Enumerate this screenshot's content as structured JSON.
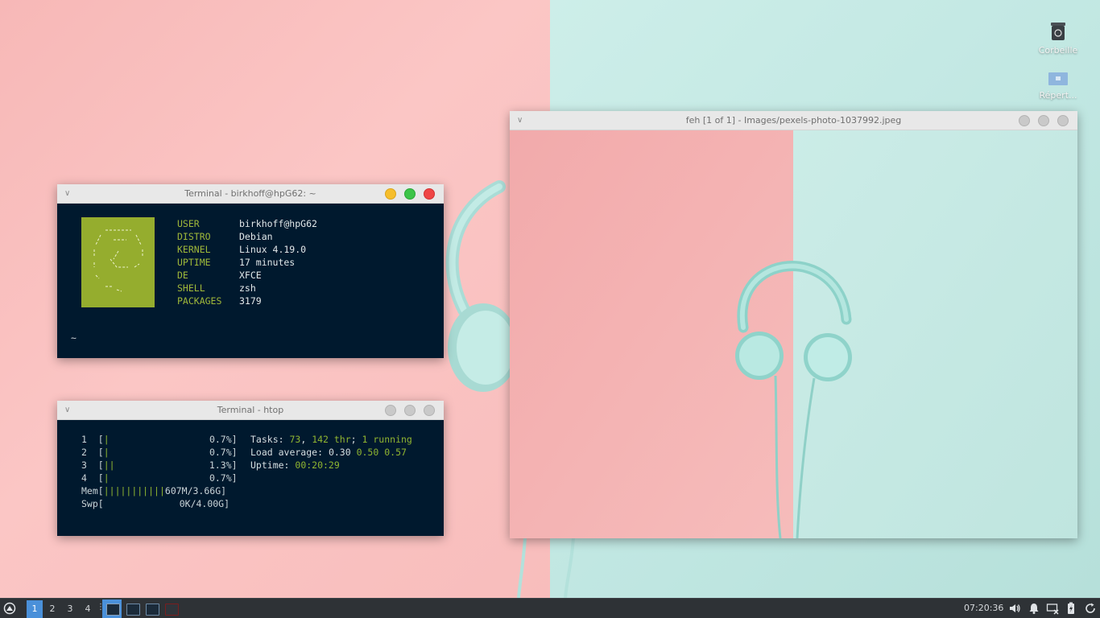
{
  "desktop": {
    "icons": [
      {
        "label": "Corbeille",
        "icon": "trash-icon"
      },
      {
        "label": "Répert...",
        "icon": "folder-icon"
      }
    ]
  },
  "neofetch_window": {
    "title": "Terminal - birkhoff@hpG62: ~",
    "info": [
      {
        "key": "USER",
        "value": "birkhoff@hpG62"
      },
      {
        "key": "DISTRO",
        "value": "Debian"
      },
      {
        "key": "KERNEL",
        "value": "Linux 4.19.0"
      },
      {
        "key": "UPTIME",
        "value": "17 minutes"
      },
      {
        "key": "DE",
        "value": "XFCE"
      },
      {
        "key": "SHELL",
        "value": "zsh"
      },
      {
        "key": "PACKAGES",
        "value": "3179"
      }
    ],
    "prompt": "~"
  },
  "htop_window": {
    "title": "Terminal - htop",
    "cpus": [
      {
        "id": "1",
        "bar": "|",
        "value": "0.7%"
      },
      {
        "id": "2",
        "bar": "|",
        "value": "0.7%"
      },
      {
        "id": "3",
        "bar": "||",
        "value": "1.3%"
      },
      {
        "id": "4",
        "bar": "|",
        "value": "0.7%"
      }
    ],
    "mem": {
      "label": "Mem",
      "bar": "|||||||||||",
      "value": "607M/3.66G"
    },
    "swp": {
      "label": "Swp",
      "bar": "",
      "value": "0K/4.00G"
    },
    "tasks": {
      "label": "Tasks: ",
      "count": "73",
      "sep1": ", ",
      "threads": "142 thr",
      "sep2": "; ",
      "running": "1",
      "running_label": " running"
    },
    "load": {
      "label": "Load average: ",
      "v1": "0.30",
      "v2": "0.50",
      "v3": "0.57"
    },
    "uptime": {
      "label": "Uptime: ",
      "value": "00:20:29"
    }
  },
  "feh_window": {
    "title": "feh [1 of 1] - Images/pexels-photo-1037992.jpeg"
  },
  "taskbar": {
    "workspaces": [
      "1",
      "2",
      "3",
      "4"
    ],
    "active_workspace": "1",
    "clock": "07:20:36",
    "task_icons": [
      "terminal-icon",
      "terminal-icon",
      "terminal-icon",
      "feh-icon"
    ]
  },
  "colors": {
    "accent": "#4a90d9",
    "term_bg": "#00192e",
    "neofetch_green": "#95ad2e",
    "wall_pink": "#f8bdbc",
    "wall_mint": "#c4e9e4"
  }
}
